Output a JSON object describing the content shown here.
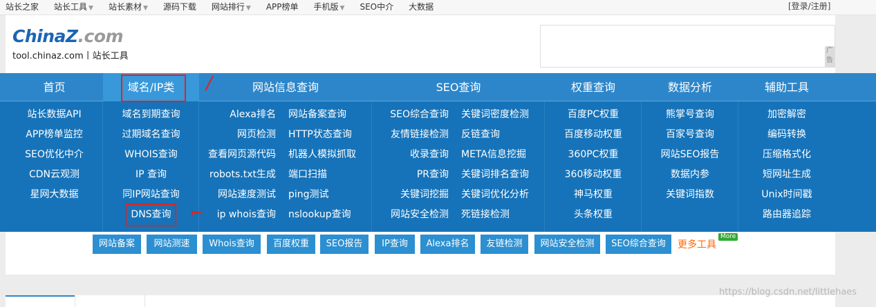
{
  "topbar": {
    "items": [
      {
        "label": "站长之家",
        "dropdown": false
      },
      {
        "label": "站长工具",
        "dropdown": true
      },
      {
        "label": "站长素材",
        "dropdown": true
      },
      {
        "label": "源码下载",
        "dropdown": false
      },
      {
        "label": "网站排行",
        "dropdown": true
      },
      {
        "label": "APP榜单",
        "dropdown": false
      },
      {
        "label": "手机版",
        "dropdown": true
      },
      {
        "label": "SEO中介",
        "dropdown": false
      },
      {
        "label": "大数据",
        "dropdown": false
      }
    ],
    "caret": "▼",
    "login": "[登录/注册]"
  },
  "header": {
    "logo_part1": "China",
    "logo_part2": "Z",
    "logo_part3": ".com",
    "logo_sub": "tool.chinaz.com丨站长工具",
    "ad_label": "广告"
  },
  "nav": {
    "tabs": [
      "首页",
      "域名/IP类",
      "网站信息查询",
      "SEO查询",
      "权重查询",
      "数据分析",
      "辅助工具"
    ],
    "col_home": [
      "站长数据API",
      "APP榜单监控",
      "SEO优化中介",
      "CDN云观测",
      "星网大数据"
    ],
    "col_domain": [
      "域名到期查询",
      "过期域名查询",
      "WHOIS查询",
      "IP 查询",
      "同IP网站查询",
      "DNS查询"
    ],
    "col_site_left": [
      "Alexa排名",
      "网页检测",
      "查看网页源代码",
      "robots.txt生成",
      "网站速度测试",
      "ip whois查询"
    ],
    "col_site_right": [
      "网站备案查询",
      "HTTP状态查询",
      "机器人模拟抓取",
      "端口扫描",
      "ping测试",
      "nslookup查询"
    ],
    "col_seo_left": [
      "SEO综合查询",
      "友情链接检测",
      "收录查询",
      "PR查询",
      "关键词挖掘",
      "网站安全检测"
    ],
    "col_seo_right": [
      "关键词密度检测",
      "反链查询",
      "META信息挖掘",
      "关键词排名查询",
      "关键词优化分析",
      "死链接检测"
    ],
    "col_weight": [
      "百度PC权重",
      "百度移动权重",
      "360PC权重",
      "360移动权重",
      "神马权重",
      "头条权重"
    ],
    "col_data": [
      "熊掌号查询",
      "百家号查询",
      "网站SEO报告",
      "数据内参",
      "关键词指数"
    ],
    "col_tools": [
      "加密解密",
      "编码转换",
      "压缩格式化",
      "短网址生成",
      "Unix时间戳",
      "路由器追踪"
    ]
  },
  "annotations": {
    "mark1": "/",
    "mark2": "⌐"
  },
  "quick_links": [
    "网站备案",
    "网站测速",
    "Whois查询",
    "百度权重",
    "SEO报告",
    "IP查询",
    "Alexa排名",
    "友链检测",
    "网站安全检测",
    "SEO综合查询"
  ],
  "more_tools": "更多工具",
  "more_badge": "More",
  "watermark": "https://blog.csdn.net/littlehaes",
  "colors": {
    "nav_bg": "#1673b9",
    "nav_head": "#2d86c9",
    "button": "#2b8fd1",
    "more": "#ff6600",
    "annotation": "#e2231a"
  }
}
